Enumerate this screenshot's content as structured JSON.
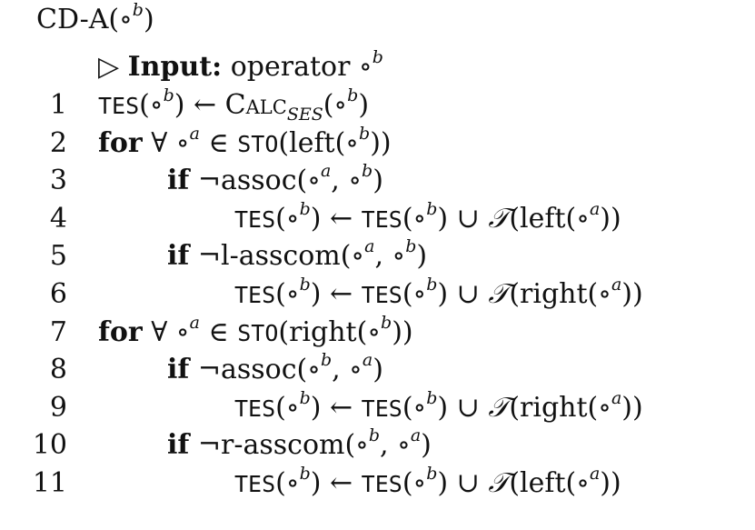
{
  "title": "CD-A(∘ᵇ)",
  "comment": {
    "triangle": "▷",
    "keyword": "Input:",
    "text": "operator ∘ᵇ"
  },
  "lines": [
    {
      "num": "1",
      "text": "TES(∘ᵇ) ← CALC_SES(∘ᵇ)"
    },
    {
      "num": "2",
      "text": "for ∀ ∘ᵃ ∈ STO(left(∘ᵇ))"
    },
    {
      "num": "3",
      "text": "if ¬assoc(∘ᵃ, ∘ᵇ)"
    },
    {
      "num": "4",
      "text": "TES(∘ᵇ) ← TES(∘ᵇ) ∪ 𝒯(left(∘ᵃ))"
    },
    {
      "num": "5",
      "text": "if ¬l-asscom(∘ᵃ, ∘ᵇ)"
    },
    {
      "num": "6",
      "text": "TES(∘ᵇ) ← TES(∘ᵇ) ∪ 𝒯(right(∘ᵃ))"
    },
    {
      "num": "7",
      "text": "for ∀ ∘ᵃ ∈ STO(right(∘ᵇ))"
    },
    {
      "num": "8",
      "text": "if ¬assoc(∘ᵇ, ∘ᵃ)"
    },
    {
      "num": "9",
      "text": "TES(∘ᵇ) ← TES(∘ᵇ) ∪ 𝒯(right(∘ᵃ))"
    },
    {
      "num": "10",
      "text": "if ¬r-asscom(∘ᵇ, ∘ᵃ)"
    },
    {
      "num": "11",
      "text": "TES(∘ᵇ) ← TES(∘ᵇ) ∪ 𝒯(left(∘ᵃ))"
    }
  ]
}
